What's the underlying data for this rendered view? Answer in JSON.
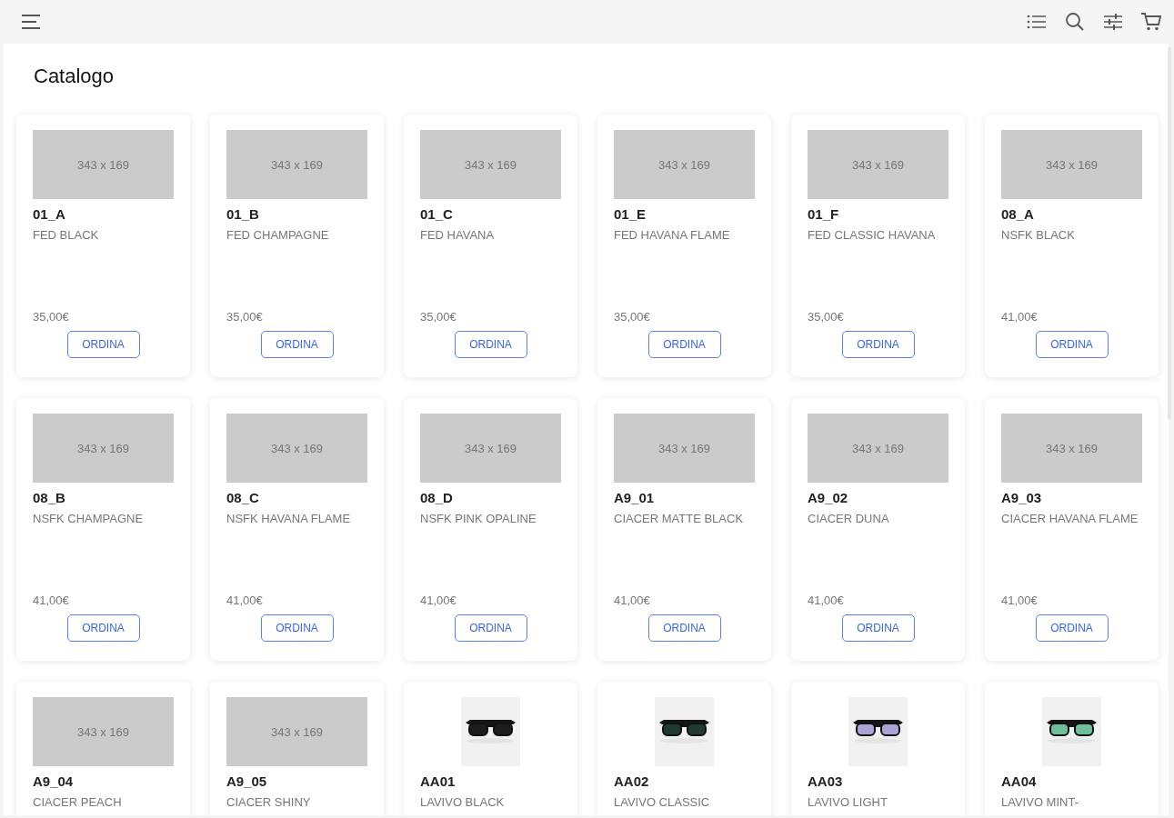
{
  "title": "Catalogo",
  "products": [
    {
      "code": "01_A",
      "name": "FED BLACK",
      "price": "35,00€",
      "button": "ORDINA",
      "image": {
        "kind": "placeholder",
        "label": "343 x 169"
      }
    },
    {
      "code": "01_B",
      "name": "FED CHAMPAGNE",
      "price": "35,00€",
      "button": "ORDINA",
      "image": {
        "kind": "placeholder",
        "label": "343 x 169"
      }
    },
    {
      "code": "01_C",
      "name": "FED HAVANA",
      "price": "35,00€",
      "button": "ORDINA",
      "image": {
        "kind": "placeholder",
        "label": "343 x 169"
      }
    },
    {
      "code": "01_E",
      "name": "FED HAVANA FLAME",
      "price": "35,00€",
      "button": "ORDINA",
      "image": {
        "kind": "placeholder",
        "label": "343 x 169"
      }
    },
    {
      "code": "01_F",
      "name": "FED CLASSIC HAVANA",
      "price": "35,00€",
      "button": "ORDINA",
      "image": {
        "kind": "placeholder",
        "label": "343 x 169"
      }
    },
    {
      "code": "08_A",
      "name": "NSFK BLACK",
      "price": "41,00€",
      "button": "ORDINA",
      "image": {
        "kind": "placeholder",
        "label": "343 x 169"
      }
    },
    {
      "code": "08_B",
      "name": "NSFK CHAMPAGNE",
      "price": "41,00€",
      "button": "ORDINA",
      "image": {
        "kind": "placeholder",
        "label": "343 x 169"
      }
    },
    {
      "code": "08_C",
      "name": "NSFK HAVANA FLAME",
      "price": "41,00€",
      "button": "ORDINA",
      "image": {
        "kind": "placeholder",
        "label": "343 x 169"
      }
    },
    {
      "code": "08_D",
      "name": "NSFK PINK OPALINE",
      "price": "41,00€",
      "button": "ORDINA",
      "image": {
        "kind": "placeholder",
        "label": "343 x 169"
      }
    },
    {
      "code": "A9_01",
      "name": "CIACER MATTE BLACK",
      "price": "41,00€",
      "button": "ORDINA",
      "image": {
        "kind": "placeholder",
        "label": "343 x 169"
      }
    },
    {
      "code": "A9_02",
      "name": "CIACER DUNA",
      "price": "41,00€",
      "button": "ORDINA",
      "image": {
        "kind": "placeholder",
        "label": "343 x 169"
      }
    },
    {
      "code": "A9_03",
      "name": "CIACER HAVANA FLAME",
      "price": "41,00€",
      "button": "ORDINA",
      "image": {
        "kind": "placeholder",
        "label": "343 x 169"
      }
    },
    {
      "code": "A9_04",
      "name": "CIACER PEACH",
      "image": {
        "kind": "placeholder",
        "label": "343 x 169"
      }
    },
    {
      "code": "A9_05",
      "name": "CIACER SHINY",
      "image": {
        "kind": "placeholder",
        "label": "343 x 169"
      }
    },
    {
      "code": "AA01",
      "name": "LAVIVO BLACK"
    },
    {
      "code": "AA02",
      "name": "LAVIVO CLASSIC"
    },
    {
      "code": "AA03",
      "name": "LAVIVO LIGHT"
    },
    {
      "code": "AA04",
      "name": "LAVIVO MINT-"
    }
  ]
}
